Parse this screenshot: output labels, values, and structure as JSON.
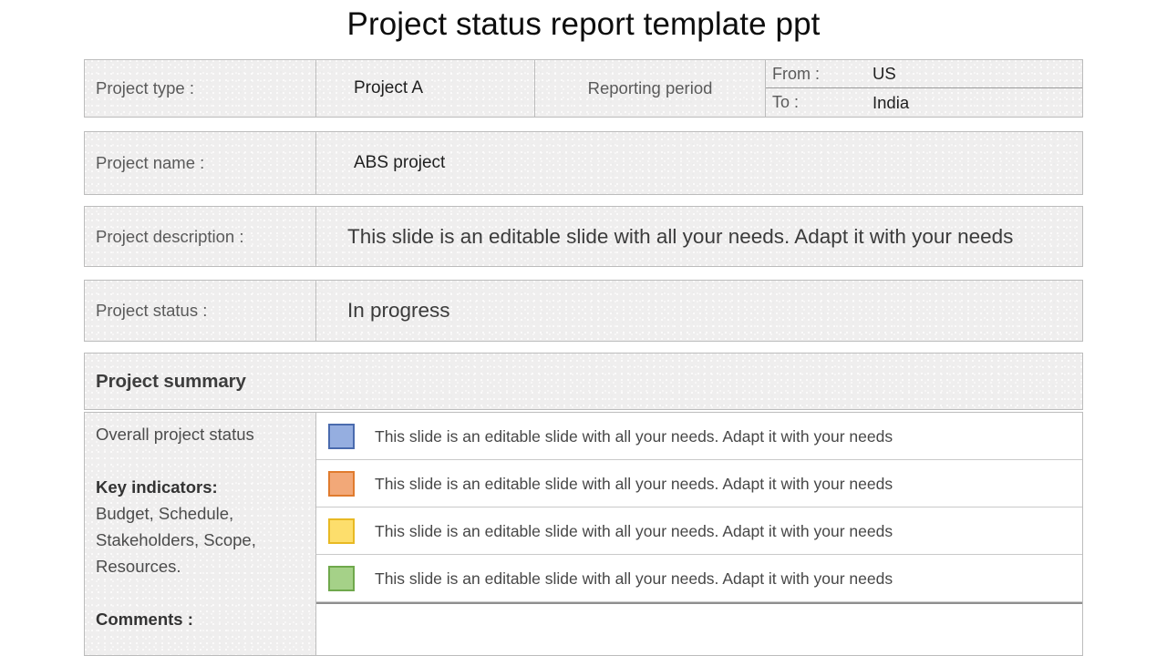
{
  "slide": {
    "title": "Project status report template ppt"
  },
  "info_rows": [
    {
      "label": "Project type :",
      "value": "Project A",
      "period_label": "Reporting period",
      "period": {
        "from_label": "From :",
        "from_value": "US",
        "to_label": "To :",
        "to_value": "India"
      }
    },
    {
      "label": "Project name :",
      "value": "ABS project"
    },
    {
      "label": "Project description :",
      "value": "This slide is an editable slide with all your needs. Adapt it with your needs"
    },
    {
      "label": "Project status :",
      "value": "In progress"
    }
  ],
  "summary": {
    "header": "Project summary",
    "left": {
      "overall_status_label": "Overall project status",
      "key_indicators_label": "Key indicators:",
      "key_indicators_lines": [
        "Budget, Schedule,",
        "Stakeholders, Scope,",
        "Resources."
      ],
      "comments_label": "Comments :"
    },
    "status_rows": [
      {
        "swatch_name": "status-swatch-blue",
        "fill": "#95AEE0",
        "border": "#4A6BAE",
        "text": "This slide is an editable slide with all your needs. Adapt it with your needs"
      },
      {
        "swatch_name": "status-swatch-orange",
        "fill": "#F2A878",
        "border": "#E07B2E",
        "text": "This slide is an editable slide with all your needs. Adapt it with your needs"
      },
      {
        "swatch_name": "status-swatch-yellow",
        "fill": "#FDDE6C",
        "border": "#E8B923",
        "text": "This slide is an editable slide with all your needs. Adapt it with your needs"
      },
      {
        "swatch_name": "status-swatch-green",
        "fill": "#A5D188",
        "border": "#6FA84C",
        "text": "This slide is an editable slide with all your needs. Adapt it with your needs"
      }
    ],
    "comments_value": ""
  },
  "colors": {
    "cell_background": "#efeeee",
    "cell_border": "#bcbcbc",
    "label_text": "#5a5a5a",
    "value_text": "#1f1f1f",
    "title_text": "#0d0d0d"
  }
}
